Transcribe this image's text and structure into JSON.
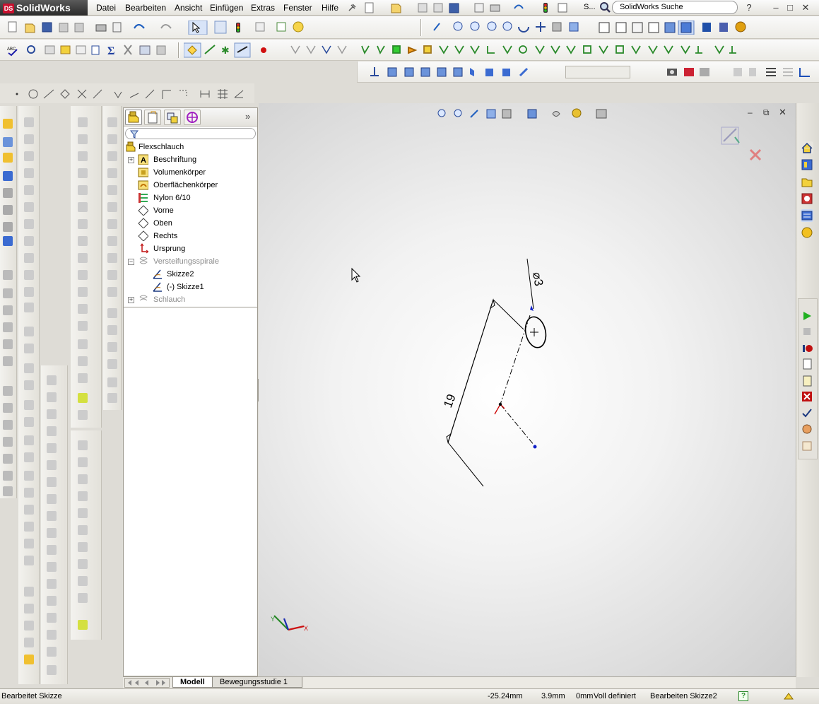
{
  "app": {
    "title": "SolidWorks",
    "brand_color": "#c8102e"
  },
  "menu": [
    "Datei",
    "Bearbeiten",
    "Ansicht",
    "Einfügen",
    "Extras",
    "Fenster",
    "Hilfe"
  ],
  "search": {
    "placeholder": "SolidWorks Suche",
    "overflow_label": "S..."
  },
  "feature_tree": {
    "root": "Flexschlauch",
    "items": [
      {
        "label": "Beschriftung",
        "icon": "annotation-icon",
        "expandable": true,
        "suppressed": false
      },
      {
        "label": "Volumenkörper",
        "icon": "solid-bodies-icon",
        "expandable": false,
        "suppressed": false
      },
      {
        "label": "Oberflächenkörper",
        "icon": "surface-bodies-icon",
        "expandable": false,
        "suppressed": false
      },
      {
        "label": "Nylon 6/10",
        "icon": "material-icon",
        "expandable": false,
        "suppressed": false
      },
      {
        "label": "Vorne",
        "icon": "plane-icon",
        "expandable": false,
        "suppressed": false
      },
      {
        "label": "Oben",
        "icon": "plane-icon",
        "expandable": false,
        "suppressed": false
      },
      {
        "label": "Rechts",
        "icon": "plane-icon",
        "expandable": false,
        "suppressed": false
      },
      {
        "label": "Ursprung",
        "icon": "origin-icon",
        "expandable": false,
        "suppressed": false
      },
      {
        "label": "Versteifungsspirale",
        "icon": "helix-icon",
        "expandable": true,
        "expanded": true,
        "suppressed": true
      },
      {
        "label": "Skizze2",
        "icon": "sketch-icon",
        "child": true,
        "suppressed": false
      },
      {
        "label": "(-) Skizze1",
        "icon": "sketch-icon",
        "child": true,
        "suppressed": false
      },
      {
        "label": "Schlauch",
        "icon": "sweep-icon",
        "expandable": true,
        "suppressed": true
      }
    ]
  },
  "sketch": {
    "dim_length": "19",
    "dim_diameter": "⌀3"
  },
  "bottom_tabs": {
    "active": "Modell",
    "other": "Bewegungsstudie 1"
  },
  "status": {
    "left": "Bearbeitet Skizze",
    "x": "-25.24mm",
    "y": "3.9mm",
    "z": "0mm",
    "definition": "Voll definiert",
    "editing": "Bearbeiten Skizze2"
  },
  "colors": {
    "accent": "#316ac5",
    "sketch_red": "#cc0000",
    "point_blue": "#1020c8"
  }
}
